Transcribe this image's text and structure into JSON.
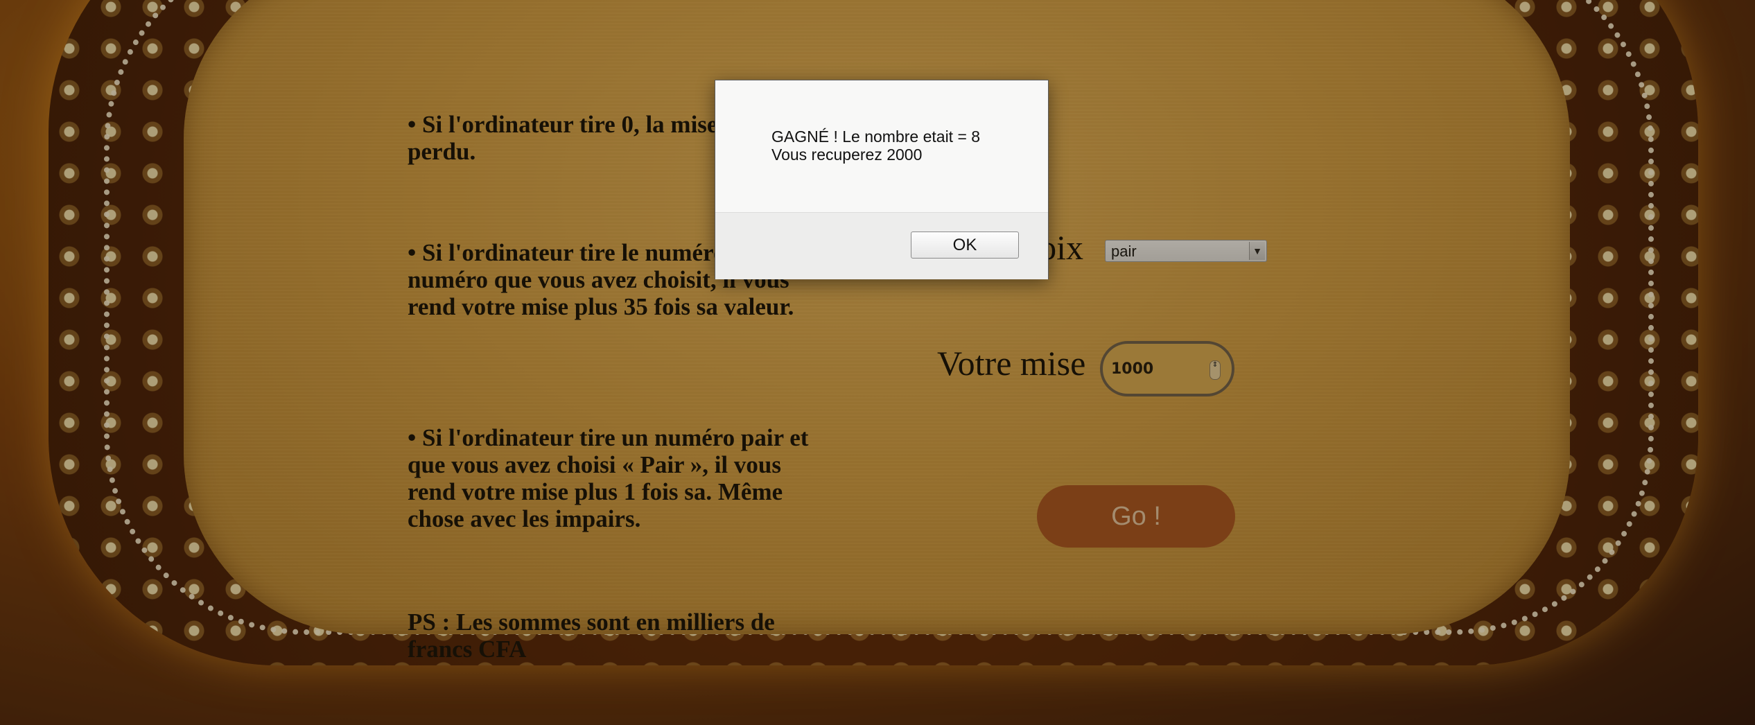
{
  "rules": {
    "rule_zero": "• Si l'ordinateur tire 0, la mise est perdu.",
    "rule_number": "• Si l'ordinateur tire le numéro le numéro que vous avez choisit, il vous rend votre mise plus 35 fois sa valeur.",
    "rule_parity": "• Si l'ordinateur tire un numéro pair et que vous avez choisi « Pair », il vous rend votre mise plus 1 fois sa. Même chose avec les impairs.",
    "ps": "PS : Les sommes sont en milliers de francs CFA"
  },
  "form": {
    "choice_label": "Votre choix",
    "choice_value": "pair",
    "bet_label": "Votre mise",
    "bet_value": "1000",
    "go_label": "Go !"
  },
  "dialog": {
    "line1": "GAGNÉ ! Le nombre etait = 8",
    "line2": "Vous recuperez 2000",
    "ok_label": "OK"
  },
  "icons": {
    "select_arrow": "chevron-down-icon",
    "stepper": "stepper-icon"
  }
}
